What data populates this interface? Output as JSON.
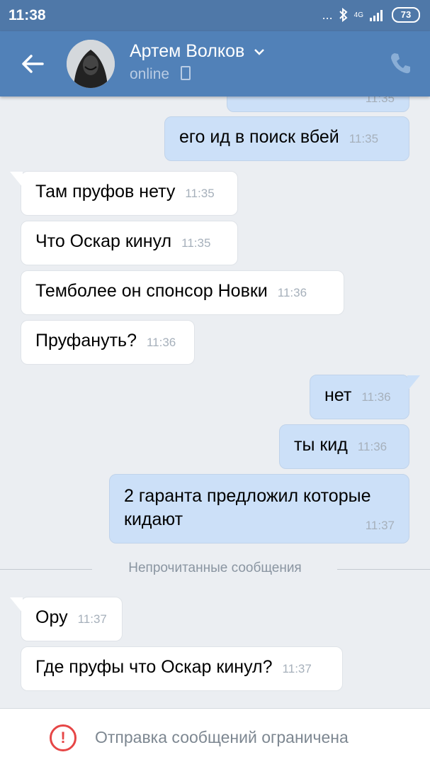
{
  "status_bar": {
    "time": "11:38",
    "dots": "...",
    "network": "4G",
    "battery": "73"
  },
  "header": {
    "name": "Артем Волков",
    "presence": "online"
  },
  "messages": [
    {
      "dir": "out",
      "text": "",
      "time": "11:35"
    },
    {
      "dir": "out",
      "text": "его ид в поиск вбей",
      "time": "11:35"
    },
    {
      "dir": "in",
      "text": "Там пруфов нету",
      "time": "11:35"
    },
    {
      "dir": "in",
      "text": "Что Оскар кинул",
      "time": "11:35"
    },
    {
      "dir": "in",
      "text": "Темболее он спонсор Новки",
      "time": "11:36"
    },
    {
      "dir": "in",
      "text": "Пруфануть?",
      "time": "11:36"
    },
    {
      "dir": "out",
      "text": "нет",
      "time": "11:36"
    },
    {
      "dir": "out",
      "text": "ты кид",
      "time": "11:36"
    },
    {
      "dir": "out",
      "text": "2 гаранта предложил которые кидают",
      "time": "11:37"
    },
    {
      "dir": "in",
      "text": "Ору",
      "time": "11:37"
    },
    {
      "dir": "in",
      "text": "Где пруфы что Оскар кинул?",
      "time": "11:37"
    }
  ],
  "divider": "Непрочитанные сообщения",
  "footer": {
    "notice": "Отправка сообщений ограничена",
    "warn_symbol": "!"
  }
}
